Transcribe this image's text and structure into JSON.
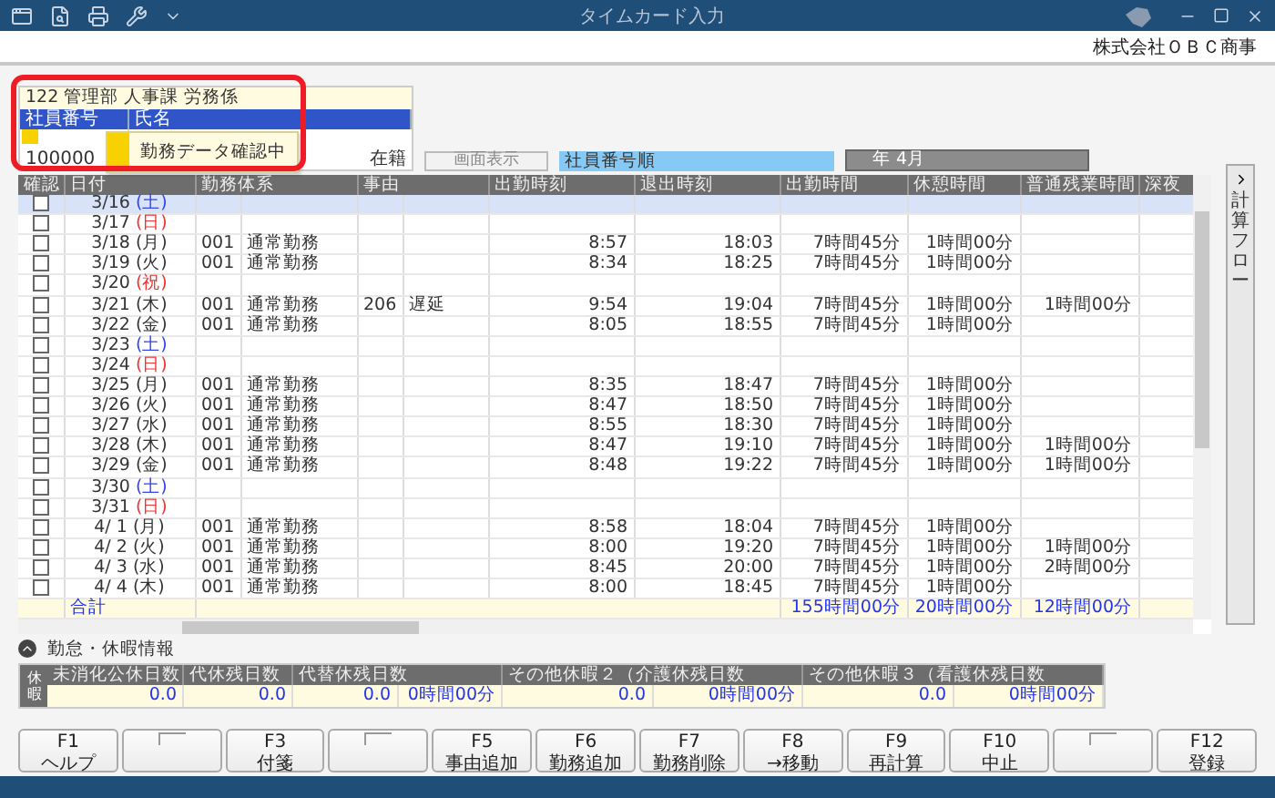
{
  "window": {
    "title": "タイムカード入力",
    "company": "株式会社ＯＢＣ商事"
  },
  "employee": {
    "department": "122 管理部 人事課 労務係",
    "columns": [
      "社員番号",
      "氏名"
    ],
    "code": "100000",
    "status": "在籍"
  },
  "tooltip": {
    "text": "勤務データ確認中"
  },
  "controls": {
    "display_button": {
      "label": "画面表示",
      "disabled": true
    },
    "sort_field": {
      "value": "社員番号順"
    },
    "period_field": {
      "value": "年 4月"
    }
  },
  "table": {
    "columns": [
      "確認",
      "日付",
      "勤務体系",
      "事由",
      "出勤時刻",
      "退出時刻",
      "出勤時間",
      "休憩時間",
      "普通残業時間",
      "深夜"
    ],
    "rows": [
      {
        "date": "3/16",
        "weekday": "(土)",
        "color": "#3344ee",
        "checked": false,
        "selected": true
      },
      {
        "date": "3/17",
        "weekday": "(日)",
        "color": "#ee3333",
        "checked": false,
        "selected": false
      },
      {
        "date": "3/18",
        "weekday": "(月)",
        "color": "#333333",
        "checked": false,
        "selected": false,
        "work_code": "001",
        "work_name": "通常勤務",
        "in_time": "8:57",
        "out_time": "18:03",
        "work_hours": "7時間45分",
        "break_hours": "1時間00分"
      },
      {
        "date": "3/19",
        "weekday": "(火)",
        "color": "#333333",
        "checked": false,
        "selected": false,
        "work_code": "001",
        "work_name": "通常勤務",
        "in_time": "8:34",
        "out_time": "18:25",
        "work_hours": "7時間45分",
        "break_hours": "1時間00分"
      },
      {
        "date": "3/20",
        "weekday": "(祝)",
        "color": "#ee3333",
        "checked": false,
        "selected": false
      },
      {
        "date": "3/21",
        "weekday": "(木)",
        "color": "#333333",
        "checked": false,
        "selected": false,
        "work_code": "001",
        "work_name": "通常勤務",
        "reason_code": "206",
        "reason_name": "遅延",
        "in_time": "9:54",
        "out_time": "19:04",
        "work_hours": "7時間45分",
        "break_hours": "1時間00分",
        "overtime": "1時間00分"
      },
      {
        "date": "3/22",
        "weekday": "(金)",
        "color": "#333333",
        "checked": false,
        "selected": false,
        "work_code": "001",
        "work_name": "通常勤務",
        "in_time": "8:05",
        "out_time": "18:55",
        "work_hours": "7時間45分",
        "break_hours": "1時間00分"
      },
      {
        "date": "3/23",
        "weekday": "(土)",
        "color": "#3344ee",
        "checked": false,
        "selected": false
      },
      {
        "date": "3/24",
        "weekday": "(日)",
        "color": "#ee3333",
        "checked": false,
        "selected": false
      },
      {
        "date": "3/25",
        "weekday": "(月)",
        "color": "#333333",
        "checked": false,
        "selected": false,
        "work_code": "001",
        "work_name": "通常勤務",
        "in_time": "8:35",
        "out_time": "18:47",
        "work_hours": "7時間45分",
        "break_hours": "1時間00分"
      },
      {
        "date": "3/26",
        "weekday": "(火)",
        "color": "#333333",
        "checked": false,
        "selected": false,
        "work_code": "001",
        "work_name": "通常勤務",
        "in_time": "8:47",
        "out_time": "18:50",
        "work_hours": "7時間45分",
        "break_hours": "1時間00分"
      },
      {
        "date": "3/27",
        "weekday": "(水)",
        "color": "#333333",
        "checked": false,
        "selected": false,
        "work_code": "001",
        "work_name": "通常勤務",
        "in_time": "8:55",
        "out_time": "18:30",
        "work_hours": "7時間45分",
        "break_hours": "1時間00分"
      },
      {
        "date": "3/28",
        "weekday": "(木)",
        "color": "#333333",
        "checked": false,
        "selected": false,
        "work_code": "001",
        "work_name": "通常勤務",
        "in_time": "8:47",
        "out_time": "19:10",
        "work_hours": "7時間45分",
        "break_hours": "1時間00分",
        "overtime": "1時間00分"
      },
      {
        "date": "3/29",
        "weekday": "(金)",
        "color": "#333333",
        "checked": false,
        "selected": false,
        "work_code": "001",
        "work_name": "通常勤務",
        "in_time": "8:48",
        "out_time": "19:22",
        "work_hours": "7時間45分",
        "break_hours": "1時間00分",
        "overtime": "1時間00分"
      },
      {
        "date": "3/30",
        "weekday": "(土)",
        "color": "#3344ee",
        "checked": false,
        "selected": false
      },
      {
        "date": "3/31",
        "weekday": "(日)",
        "color": "#ee3333",
        "checked": false,
        "selected": false
      },
      {
        "date": "4/ 1",
        "weekday": "(月)",
        "color": "#333333",
        "checked": false,
        "selected": false,
        "work_code": "001",
        "work_name": "通常勤務",
        "in_time": "8:58",
        "out_time": "18:04",
        "work_hours": "7時間45分",
        "break_hours": "1時間00分"
      },
      {
        "date": "4/ 2",
        "weekday": "(火)",
        "color": "#333333",
        "checked": false,
        "selected": false,
        "work_code": "001",
        "work_name": "通常勤務",
        "in_time": "8:00",
        "out_time": "19:20",
        "work_hours": "7時間45分",
        "break_hours": "1時間00分",
        "overtime": "1時間00分"
      },
      {
        "date": "4/ 3",
        "weekday": "(水)",
        "color": "#333333",
        "checked": false,
        "selected": false,
        "work_code": "001",
        "work_name": "通常勤務",
        "in_time": "8:45",
        "out_time": "20:00",
        "work_hours": "7時間45分",
        "break_hours": "1時間00分",
        "overtime": "2時間00分"
      },
      {
        "date": "4/ 4",
        "weekday": "(木)",
        "color": "#333333",
        "checked": false,
        "selected": false,
        "work_code": "001",
        "work_name": "通常勤務",
        "in_time": "8:00",
        "out_time": "18:45",
        "work_hours": "7時間45分",
        "break_hours": "1時間00分"
      }
    ],
    "total": {
      "label": "合計",
      "work_hours": "155時間00分",
      "break_hours": "20時間00分",
      "overtime": "12時間00分"
    }
  },
  "side_tab": {
    "label": "計算フロー"
  },
  "leave_info": {
    "title": "勤怠・休暇情報",
    "expanded": true,
    "side_label": "休暇",
    "columns": [
      {
        "label": "未消化公休日数",
        "values": [
          "0.0"
        ]
      },
      {
        "label": "代休残日数",
        "values": [
          "0.0"
        ]
      },
      {
        "label": "代替休残日数",
        "values": [
          "0.0",
          "0時間00分"
        ]
      },
      {
        "label": "その他休暇２（介護休残日数",
        "values": [
          "0.0",
          "0時間00分"
        ]
      },
      {
        "label": "その他休暇３（看護休残日数",
        "values": [
          "0.0",
          "0時間00分"
        ]
      }
    ]
  },
  "function_keys": [
    {
      "kind": "key",
      "key": "F1",
      "label": "ヘルプ"
    },
    {
      "kind": "blank"
    },
    {
      "kind": "key",
      "key": "F3",
      "label": "付箋"
    },
    {
      "kind": "blank"
    },
    {
      "kind": "key",
      "key": "F5",
      "label": "事由追加"
    },
    {
      "kind": "key",
      "key": "F6",
      "label": "勤務追加"
    },
    {
      "kind": "key",
      "key": "F7",
      "label": "勤務削除"
    },
    {
      "kind": "key",
      "key": "F8",
      "label": "→移動"
    },
    {
      "kind": "key",
      "key": "F9",
      "label": "再計算"
    },
    {
      "kind": "key",
      "key": "F10",
      "label": "中止"
    },
    {
      "kind": "blank"
    },
    {
      "kind": "key",
      "key": "F12",
      "label": "登録"
    }
  ]
}
